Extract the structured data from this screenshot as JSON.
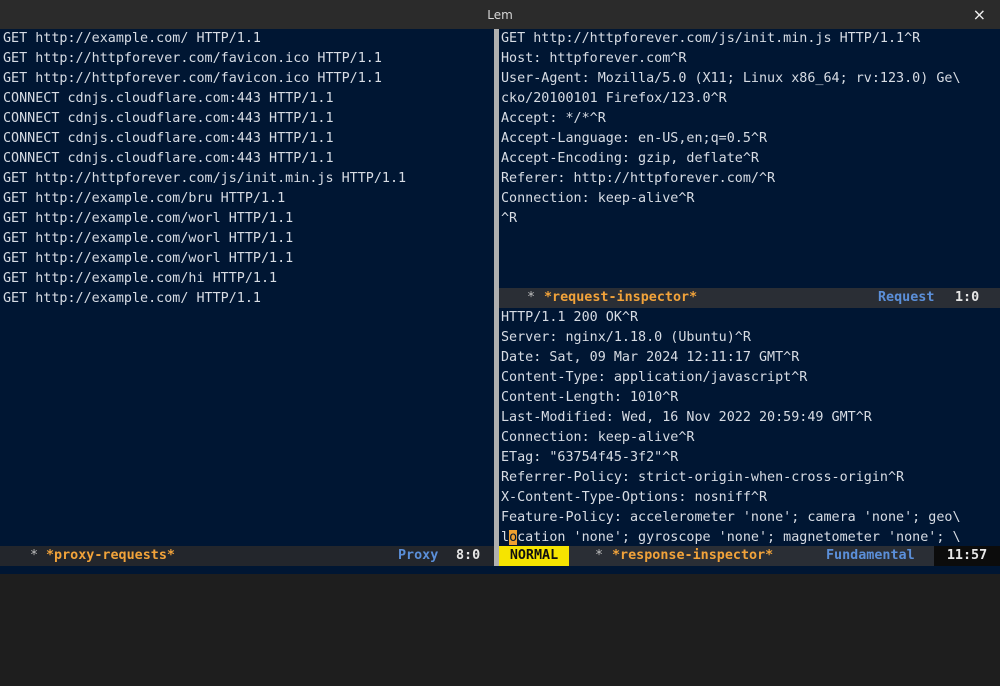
{
  "window": {
    "title": "Lem",
    "close_label": "×"
  },
  "left_pane": {
    "lines": [
      "GET http://example.com/ HTTP/1.1",
      "GET http://httpforever.com/favicon.ico HTTP/1.1",
      "GET http://httpforever.com/favicon.ico HTTP/1.1",
      "CONNECT cdnjs.cloudflare.com:443 HTTP/1.1",
      "CONNECT cdnjs.cloudflare.com:443 HTTP/1.1",
      "CONNECT cdnjs.cloudflare.com:443 HTTP/1.1",
      "CONNECT cdnjs.cloudflare.com:443 HTTP/1.1",
      "GET http://httpforever.com/js/init.min.js HTTP/1.1",
      "GET http://example.com/bru HTTP/1.1",
      "GET http://example.com/worl HTTP/1.1",
      "GET http://example.com/worl HTTP/1.1",
      "GET http://example.com/worl HTTP/1.1",
      "GET http://example.com/hi HTTP/1.1",
      "GET http://example.com/ HTTP/1.1"
    ],
    "modeline": {
      "star": "*",
      "buffer": "*proxy-requests*",
      "mode": "Proxy",
      "position": "8:0"
    }
  },
  "request_pane": {
    "lines": [
      "GET http://httpforever.com/js/init.min.js HTTP/1.1^R",
      "Host: httpforever.com^R",
      "User-Agent: Mozilla/5.0 (X11; Linux x86_64; rv:123.0) Ge\\",
      "cko/20100101 Firefox/123.0^R",
      "Accept: */*^R",
      "Accept-Language: en-US,en;q=0.5^R",
      "Accept-Encoding: gzip, deflate^R",
      "Referer: http://httpforever.com/^R",
      "Connection: keep-alive^R",
      "^R"
    ],
    "modeline": {
      "star": "*",
      "buffer": "*request-inspector*",
      "mode": "Request",
      "position": "1:0"
    }
  },
  "response_pane": {
    "lines": [
      "HTTP/1.1 200 OK^R",
      "Server: nginx/1.18.0 (Ubuntu)^R",
      "Date: Sat, 09 Mar 2024 12:11:17 GMT^R",
      "Content-Type: application/javascript^R",
      "Content-Length: 1010^R",
      "Last-Modified: Wed, 16 Nov 2022 20:59:49 GMT^R",
      "Connection: keep-alive^R",
      "ETag: \"63754f45-3f2\"^R",
      "Referrer-Policy: strict-origin-when-cross-origin^R",
      "X-Content-Type-Options: nosniff^R",
      "Feature-Policy: accelerometer 'none'; camera 'none'; geo\\"
    ],
    "cursor_line": {
      "before": "l",
      "cursor": "o",
      "after": "cation 'none'; gyroscope 'none'; magnetometer 'none'; \\"
    },
    "modeline": {
      "vim_state": "NORMAL",
      "star": "*",
      "buffer": "*response-inspector*",
      "mode": "Fundamental",
      "position": "11:57"
    }
  }
}
